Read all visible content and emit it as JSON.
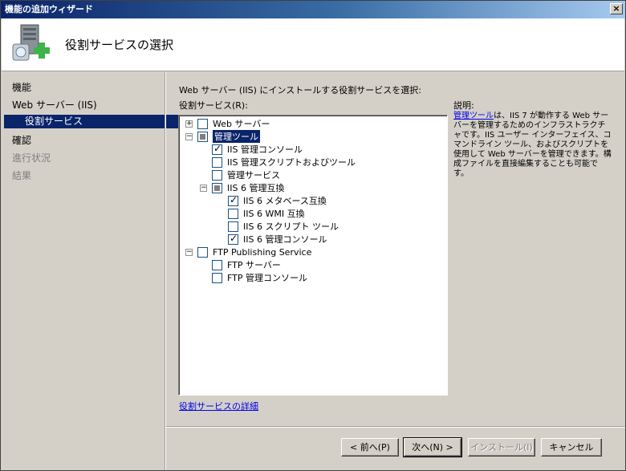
{
  "window": {
    "title": "機能の追加ウィザード",
    "close_label": "×"
  },
  "header": {
    "title": "役割サービスの選択",
    "icon": "server-add-icon"
  },
  "nav": {
    "items": [
      {
        "label": "機能",
        "state": "normal"
      },
      {
        "label": "Web サーバー (IIS)",
        "state": "normal"
      },
      {
        "label": "役割サービス",
        "state": "selected"
      },
      {
        "label": "確認",
        "state": "normal"
      },
      {
        "label": "進行状況",
        "state": "disabled"
      },
      {
        "label": "結果",
        "state": "disabled"
      }
    ]
  },
  "main": {
    "instruction": "Web サーバー (IIS) にインストールする役割サービスを選択:",
    "list_label": "役割サービス(R):",
    "tree": [
      {
        "label": "Web サーバー",
        "expander": "+",
        "check": "none"
      },
      {
        "label": "管理ツール",
        "expander": "−",
        "check": "partial",
        "selected": true
      },
      {
        "label": "IIS 管理コンソール",
        "check": "checked"
      },
      {
        "label": "IIS 管理スクリプトおよびツール",
        "check": "none"
      },
      {
        "label": "管理サービス",
        "check": "none"
      },
      {
        "label": "IIS 6 管理互換",
        "expander": "−",
        "check": "partial"
      },
      {
        "label": "IIS 6 メタベース互換",
        "check": "checked"
      },
      {
        "label": "IIS 6 WMI 互換",
        "check": "none"
      },
      {
        "label": "IIS 6 スクリプト ツール",
        "check": "none"
      },
      {
        "label": "IIS 6 管理コンソール",
        "check": "checked"
      },
      {
        "label": "FTP Publishing Service",
        "expander": "−",
        "check": "none"
      },
      {
        "label": "FTP サーバー",
        "check": "none"
      },
      {
        "label": "FTP 管理コンソール",
        "check": "none"
      }
    ],
    "more_link": "役割サービスの詳細"
  },
  "description": {
    "title": "説明:",
    "link": "管理ツール",
    "text": "は、IIS 7 が動作する Web サーバーを管理するためのインフラストラクチャです。IIS ユーザー インターフェイス、コマンドライン ツール、およびスクリプトを使用して Web サーバーを管理できます。構成ファイルを直接編集することも可能です。"
  },
  "buttons": {
    "back": "< 前へ(P)",
    "next": "次へ(N) >",
    "install": "インストール(I)",
    "cancel": "キャンセル"
  }
}
